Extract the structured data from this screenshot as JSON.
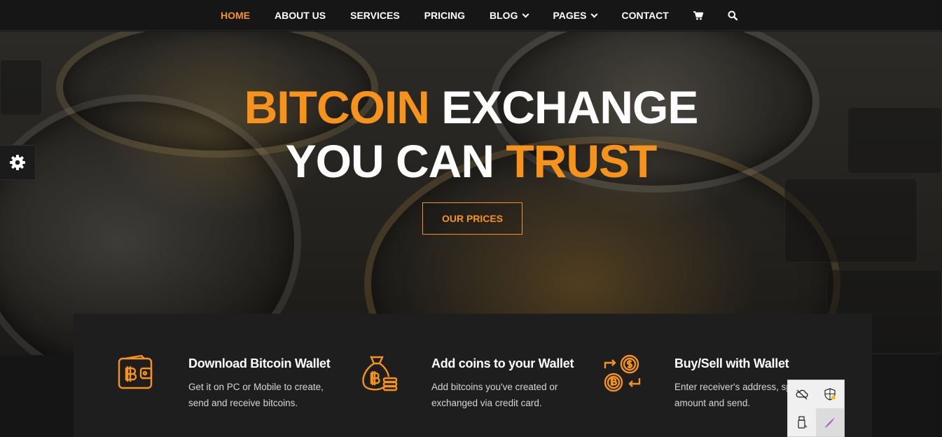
{
  "nav": {
    "items": [
      {
        "label": "HOME",
        "active": true
      },
      {
        "label": "ABOUT US"
      },
      {
        "label": "SERVICES"
      },
      {
        "label": "PRICING"
      },
      {
        "label": "BLOG",
        "dropdown": true
      },
      {
        "label": "PAGES",
        "dropdown": true
      },
      {
        "label": "CONTACT"
      }
    ],
    "cart_icon": "cart-icon",
    "search_icon": "search-icon"
  },
  "hero": {
    "line1_highlight": "BITCOIN",
    "line1_rest": "EXCHANGE",
    "line2_rest": "YOU CAN",
    "line2_highlight": "TRUST",
    "button": "OUR PRICES"
  },
  "settings_icon": "gear-icon",
  "features": [
    {
      "icon": "wallet-icon",
      "title": "Download Bitcoin Wallet",
      "desc": "Get it on PC or Mobile to create, send and receive bitcoins."
    },
    {
      "icon": "money-bag-icon",
      "title": "Add coins to your Wallet",
      "desc": "Add bitcoins you've created or exchanged via credit card."
    },
    {
      "icon": "exchange-icon",
      "title": "Buy/Sell with Wallet",
      "desc": "Enter receiver's address, sp the amount and send."
    }
  ],
  "tray": {
    "icons": [
      "onedrive-offline-icon",
      "defender-icon",
      "usb-drive-icon",
      "pen-icon"
    ]
  },
  "colors": {
    "accent": "#f7931a",
    "nav_bg": "#161616",
    "features_bg": "#1e1e1e"
  }
}
